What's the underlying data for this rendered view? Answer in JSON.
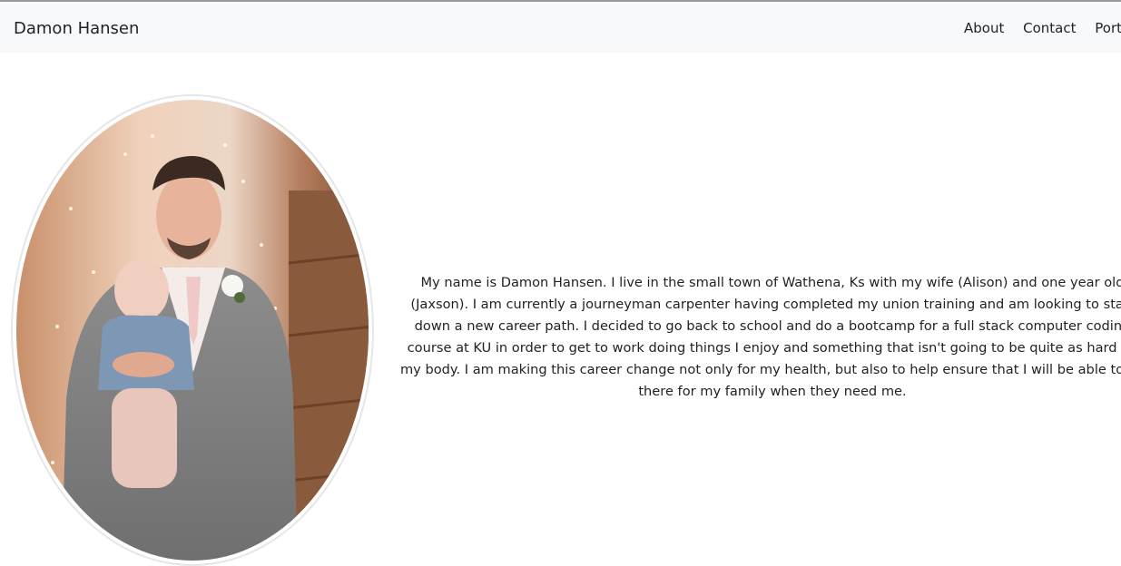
{
  "nav": {
    "brand": "Damon Hansen",
    "links": [
      "About",
      "Contact",
      "Portfolio"
    ]
  },
  "profile": {
    "photo_icon": "profile-photo",
    "bio": "My name is Damon Hansen. I live in the small town of Wathena, Ks with my wife (Alison) and one year old (Jaxson). I am currently a journeyman carpenter having completed my union training and am looking to start down a new career path. I decided to go back to school and do a bootcamp for a full stack computer coding course at KU in order to get to work doing things I enjoy and something that isn't going to be quite as hard on my body. I am making this career change not only for my health, but also to help ensure that I will be able to be there for my family when they need me."
  },
  "colors": {
    "navbar_bg": "#f8f9fa",
    "text": "#222222"
  }
}
